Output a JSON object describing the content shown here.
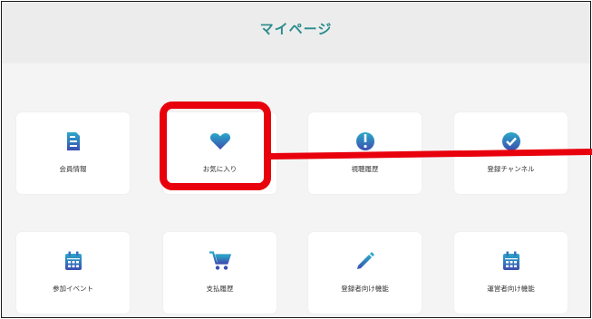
{
  "header": {
    "title": "マイページ"
  },
  "tiles": [
    {
      "label": "会員情報",
      "icon": "member-card-icon"
    },
    {
      "label": "お気に入り",
      "icon": "heart-icon"
    },
    {
      "label": "視聴履歴",
      "icon": "history-icon"
    },
    {
      "label": "登録チャンネル",
      "icon": "check-badge-icon"
    },
    {
      "label": "参加イベント",
      "icon": "calendar-icon"
    },
    {
      "label": "支払履歴",
      "icon": "cart-icon"
    },
    {
      "label": "登録者向け機能",
      "icon": "pencil-icon"
    },
    {
      "label": "運営者向け機能",
      "icon": "calendar-icon"
    }
  ],
  "colors": {
    "accent": "#2a8c8c",
    "icon_gradient_start": "#2aa9c9",
    "icon_gradient_end": "#3b4fb0",
    "highlight": "#e8000d"
  }
}
